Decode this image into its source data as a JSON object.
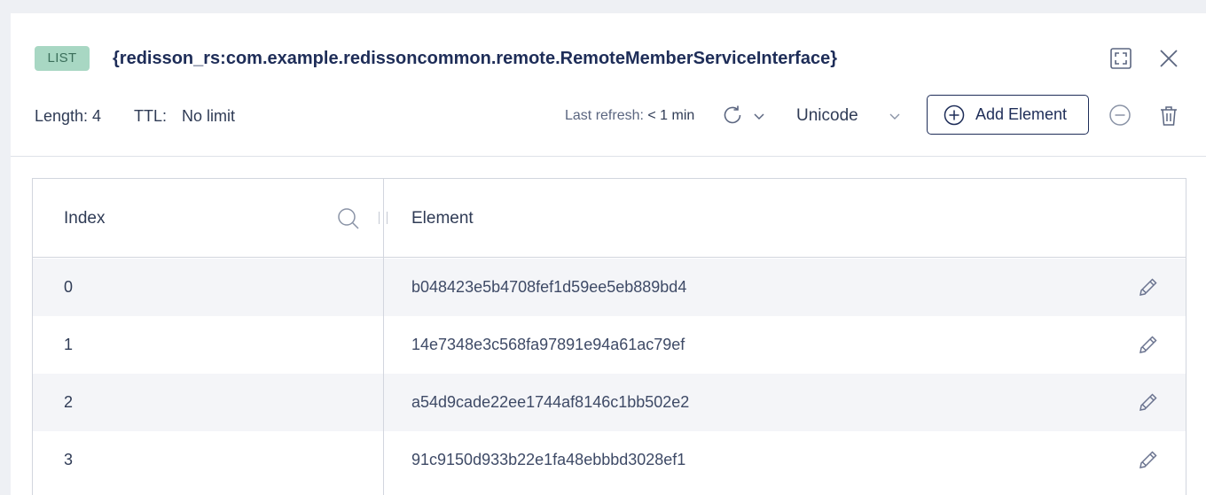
{
  "header": {
    "key_type": "LIST",
    "key_name": "{redisson_rs:com.example.redissoncommon.remote.RemoteMemberServiceInterface}",
    "length": "Length: 4",
    "ttl_label": "TTL:",
    "ttl_value": "No limit",
    "last_refresh_label": "Last refresh:",
    "last_refresh_value": "< 1 min",
    "format": "Unicode",
    "add_element_label": "Add Element"
  },
  "table": {
    "columns": [
      "Index",
      "Element"
    ],
    "rows": [
      {
        "index": "0",
        "element": "b048423e5b4708fef1d59ee5eb889bd4"
      },
      {
        "index": "1",
        "element": "14e7348e3c568fa97891e94a61ac79ef"
      },
      {
        "index": "2",
        "element": "a54d9cade22ee1744af8146c1bb502e2"
      },
      {
        "index": "3",
        "element": "91c9150d933b22e1fa48ebbbd3028ef1"
      }
    ]
  },
  "icons": {
    "fullscreen": "fullscreen-icon",
    "close": "close-icon",
    "refresh": "refresh-icon",
    "refresh_menu": "chevron-down-icon",
    "format_caret": "chevron-down-icon",
    "add": "plus-circle-icon",
    "remove": "minus-circle-icon",
    "delete": "trash-icon",
    "search": "search-icon",
    "edit": "pencil-icon"
  },
  "colors": {
    "badge_bg": "#a8d7c3",
    "badge_text": "#3a6e5a",
    "primary": "#1e2d58",
    "row_alt": "#f4f5f8"
  }
}
